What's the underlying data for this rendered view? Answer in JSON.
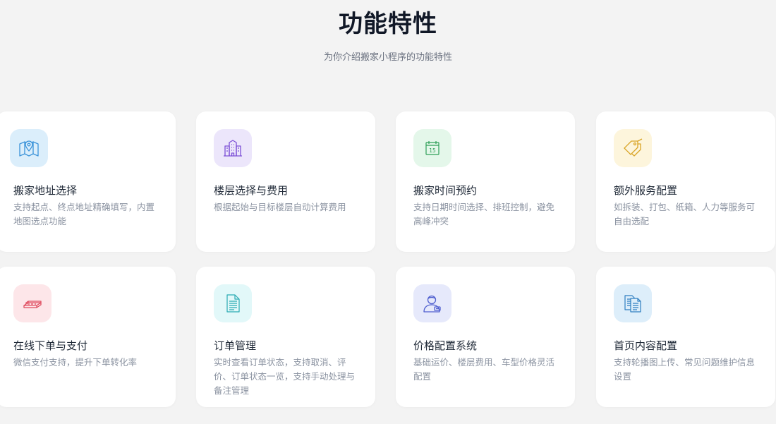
{
  "header": {
    "title": "功能特性",
    "subtitle": "为你介绍搬家小程序的功能特性"
  },
  "features": [
    {
      "title": "搬家地址选择",
      "desc": "支持起点、终点地址精确填写，内置地图选点功能",
      "icon": "map-icon",
      "bg": "#dbeefb",
      "color": "#3b93d9"
    },
    {
      "title": "楼层选择与费用",
      "desc": "根据起始与目标楼层自动计算费用",
      "icon": "building-icon",
      "bg": "#ece6fb",
      "color": "#7c4fd6"
    },
    {
      "title": "搬家时间预约",
      "desc": "支持日期时间选择、排班控制，避免高峰冲突",
      "icon": "calendar-icon",
      "bg": "#e4f7ea",
      "color": "#2e9e57",
      "icon_text": "15"
    },
    {
      "title": "额外服务配置",
      "desc": "如拆装、打包、纸箱、人力等服务可自由选配",
      "icon": "tags-icon",
      "bg": "#fdf5dc",
      "color": "#d9a425"
    },
    {
      "title": "在线下单与支付",
      "desc": "微信支付支持，提升下单转化率",
      "icon": "cash-icon",
      "bg": "#fde6e9",
      "color": "#df4b5e"
    },
    {
      "title": "订单管理",
      "desc": "实时查看订单状态，支持取消、评价、订单状态一览，支持手动处理与备注管理",
      "icon": "document-icon",
      "bg": "#e2f8f9",
      "color": "#2aaab3"
    },
    {
      "title": "价格配置系统",
      "desc": "基础运价、楼层费用、车型价格灵活配置",
      "icon": "user-admin-icon",
      "bg": "#e6e9fb",
      "color": "#4f5fcf"
    },
    {
      "title": "首页内容配置",
      "desc": "支持轮播图上传、常见问题维护信息设置",
      "icon": "documents-icon",
      "bg": "#ddeefa",
      "color": "#2f7fc0"
    }
  ]
}
